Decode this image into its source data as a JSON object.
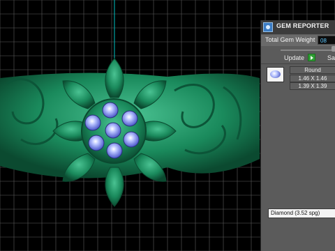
{
  "viewport": {
    "background": "#000000",
    "grid_color": "#5e5e5e",
    "model_color": "#1a8a5c",
    "stone_color": "#8fa0ff"
  },
  "panel": {
    "title": "GEM REPORTER",
    "total_gem_weight_label": "Total Gem Weight",
    "total_gem_weight_value": "08",
    "update_label": "Update",
    "save_label": "Sa",
    "gems": [
      {
        "icon": "round-gem-icon",
        "shape": "Round",
        "sizes": [
          "1.46 X 1.46",
          "1.39 X 1.39"
        ]
      }
    ],
    "material": "Diamond    (3.52 spg)"
  }
}
